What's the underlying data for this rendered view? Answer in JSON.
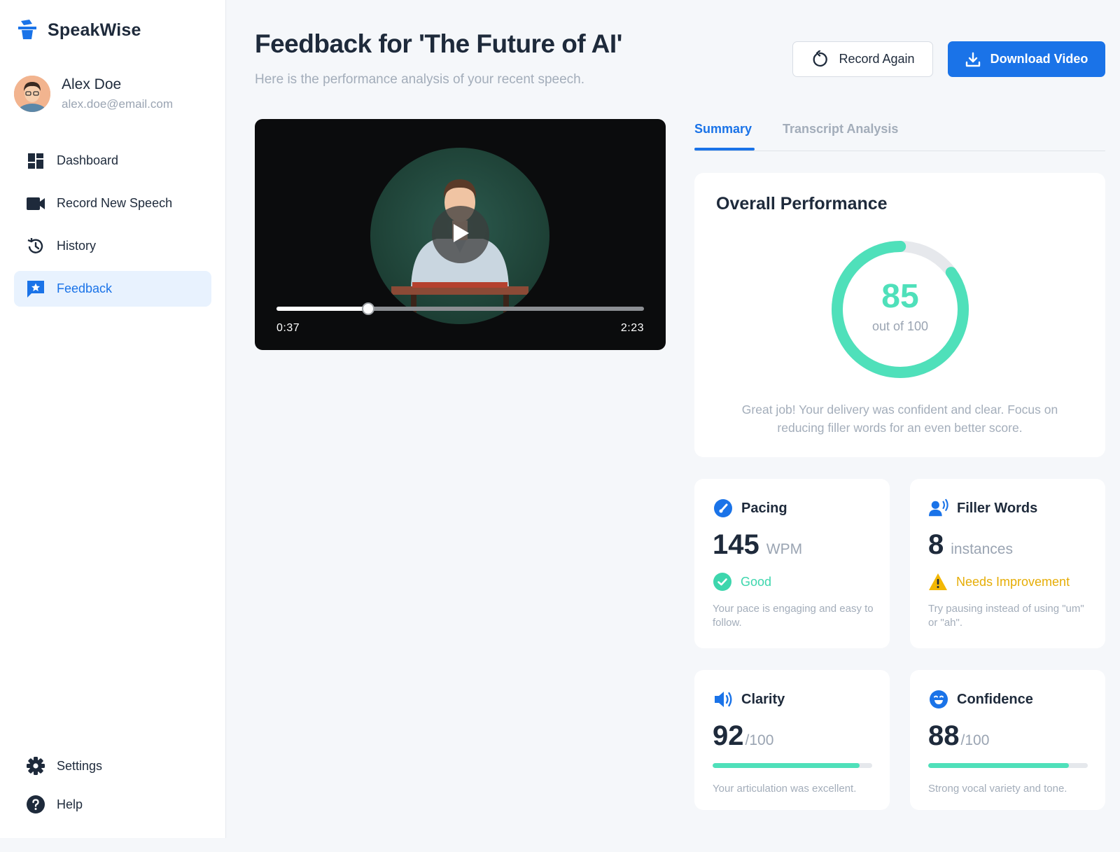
{
  "app": {
    "name": "SpeakWise",
    "accent": "#1a73e8"
  },
  "user": {
    "name": "Alex Doe",
    "email": "alex.doe@email.com"
  },
  "sidebar": {
    "items": [
      {
        "label": "Dashboard",
        "icon": "dashboard-icon"
      },
      {
        "label": "Record New Speech",
        "icon": "video-camera-icon"
      },
      {
        "label": "History",
        "icon": "history-icon"
      },
      {
        "label": "Feedback",
        "icon": "feedback-icon",
        "active": true
      }
    ],
    "bottom": [
      {
        "label": "Settings",
        "icon": "gear-icon"
      },
      {
        "label": "Help",
        "icon": "help-icon"
      }
    ]
  },
  "header": {
    "title": "Feedback for 'The Future of AI'",
    "subtitle": "Here is the performance analysis of your recent speech.",
    "record_again": "Record Again",
    "download": "Download Video"
  },
  "video": {
    "current_time": "0:37",
    "total_time": "2:23",
    "progress": 0.25
  },
  "tabs": [
    {
      "label": "Summary",
      "active": true
    },
    {
      "label": "Transcript Analysis"
    }
  ],
  "overall": {
    "title": "Overall Performance",
    "score": "85",
    "score_value": 85,
    "out_of": "out of 100",
    "message": "Great job! Your delivery was confident and clear. Focus on reducing filler words for an even better score.",
    "ring_color": "#4fe0ba"
  },
  "metrics": {
    "pacing": {
      "title": "Pacing",
      "value": "145",
      "unit": "WPM",
      "status": "Good",
      "note": "Your pace is engaging and easy to follow."
    },
    "filler": {
      "title": "Filler Words",
      "value": "8",
      "unit": "instances",
      "status": "Needs Improvement",
      "note": "Try pausing instead of using \"um\" or \"ah\"."
    },
    "clarity": {
      "title": "Clarity",
      "value": "92",
      "unit": "/100",
      "score": 92,
      "note": "Your articulation was excellent."
    },
    "confidence": {
      "title": "Confidence",
      "value": "88",
      "unit": "/100",
      "score": 88,
      "note": "Strong vocal variety and tone."
    }
  }
}
